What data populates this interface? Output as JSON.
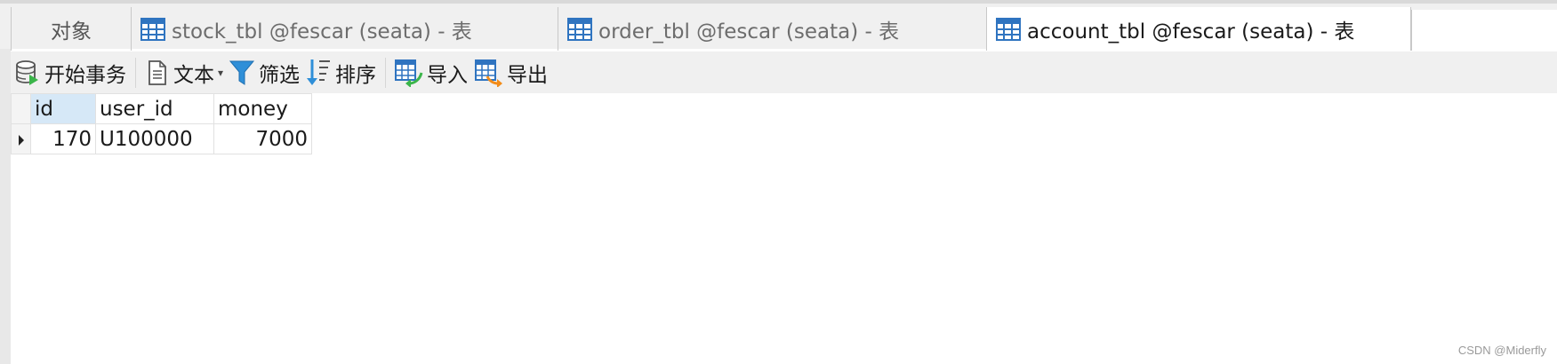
{
  "tabs": {
    "objects": "对象",
    "stock": "stock_tbl @fescar (seata) - 表",
    "order": "order_tbl @fescar (seata) - 表",
    "account": "account_tbl @fescar (seata) - 表"
  },
  "toolbar": {
    "begin_transaction": "开始事务",
    "text": "文本",
    "filter": "筛选",
    "sort": "排序",
    "import": "导入",
    "export": "导出"
  },
  "grid": {
    "columns": [
      "id",
      "user_id",
      "money"
    ],
    "rows": [
      [
        "170",
        "U100000",
        "7000"
      ]
    ]
  },
  "icons": {
    "table": "table-icon",
    "transaction": "database-icon",
    "text": "document-icon",
    "filter": "funnel-icon",
    "sort": "sort-icon",
    "import": "import-icon",
    "export": "export-icon"
  },
  "watermark": "CSDN @Miderfly"
}
